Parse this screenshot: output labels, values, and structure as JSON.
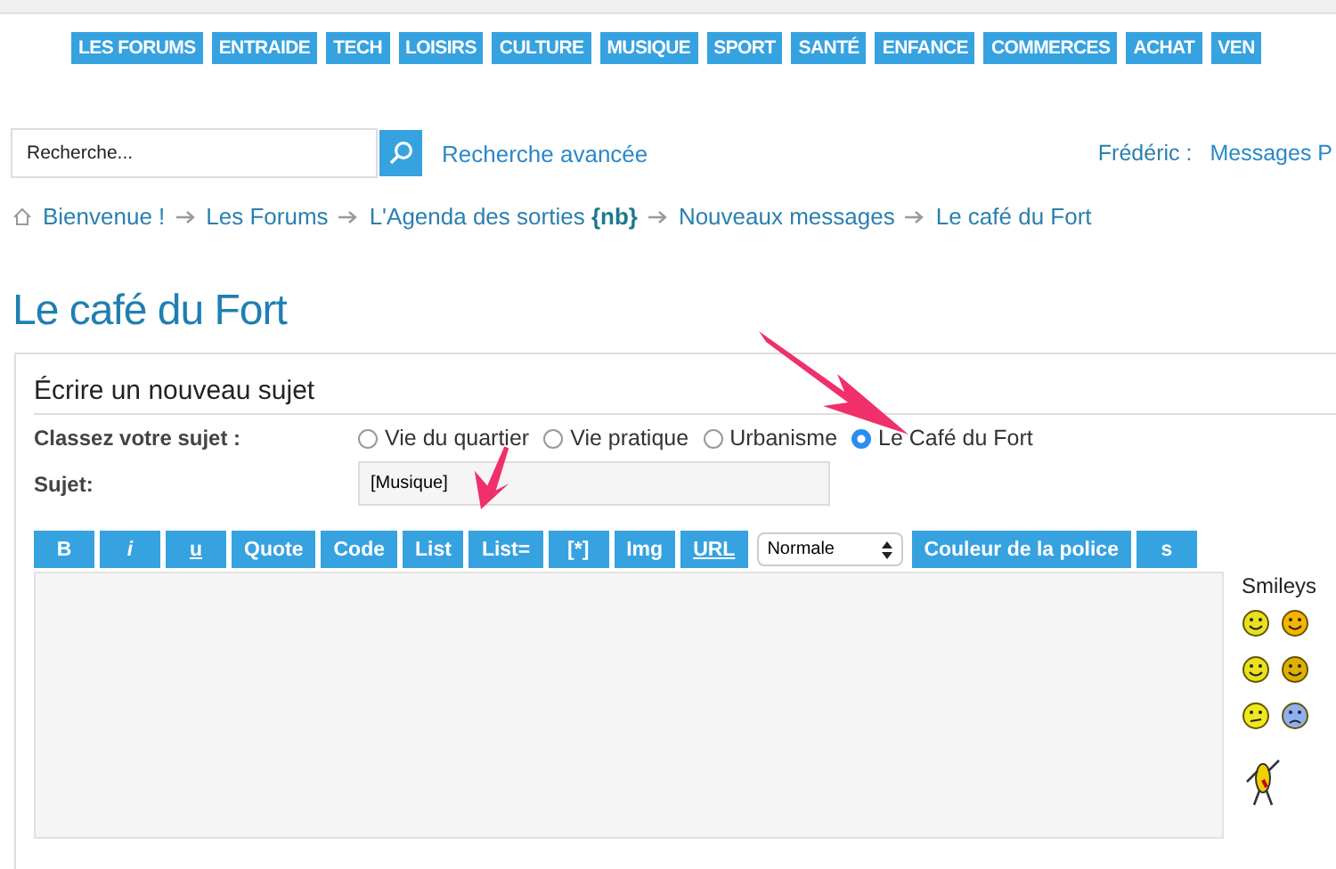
{
  "nav": [
    {
      "label": "LES FORUMS"
    },
    {
      "label": "ENTRAIDE"
    },
    {
      "label": "TECH"
    },
    {
      "label": "LOISIRS"
    },
    {
      "label": "CULTURE"
    },
    {
      "label": "MUSIQUE"
    },
    {
      "label": "SPORT"
    },
    {
      "label": "SANTÉ"
    },
    {
      "label": "ENFANCE"
    },
    {
      "label": "COMMERCES"
    },
    {
      "label": "ACHAT"
    },
    {
      "label": "VEN"
    }
  ],
  "search": {
    "placeholder": "Recherche...",
    "advanced_link": "Recherche avancée"
  },
  "user": {
    "name": "Frédéric :",
    "link": "Messages P"
  },
  "breadcrumb": [
    "Bienvenue !",
    "Les Forums",
    "L'Agenda des sorties **{nb}**",
    "Nouveaux messages",
    "Le café du Fort"
  ],
  "page_title": "Le café du Fort",
  "form": {
    "heading": "Écrire un nouveau sujet",
    "category_label": "Classez votre sujet :",
    "categories": [
      {
        "label": "Vie du quartier",
        "selected": false
      },
      {
        "label": "Vie pratique",
        "selected": false
      },
      {
        "label": "Urbanisme",
        "selected": false
      },
      {
        "label": "Le Café du Fort",
        "selected": true
      }
    ],
    "subject_label": "Sujet:",
    "subject_value": "[Musique]",
    "toolbar": [
      {
        "kind": "bold",
        "label": "B"
      },
      {
        "kind": "italic",
        "label": "i"
      },
      {
        "kind": "underline",
        "label": "u"
      },
      {
        "kind": "button",
        "label": "Quote"
      },
      {
        "kind": "button",
        "label": "Code"
      },
      {
        "kind": "button",
        "label": "List"
      },
      {
        "kind": "button",
        "label": "List="
      },
      {
        "kind": "button",
        "label": "[*]"
      },
      {
        "kind": "button",
        "label": "Img"
      },
      {
        "kind": "underline",
        "label": "URL"
      },
      {
        "kind": "select",
        "label": "Normale"
      },
      {
        "kind": "button",
        "label": "Couleur de la police"
      },
      {
        "kind": "button",
        "label": "s"
      }
    ],
    "smileys_label": "Smileys"
  }
}
